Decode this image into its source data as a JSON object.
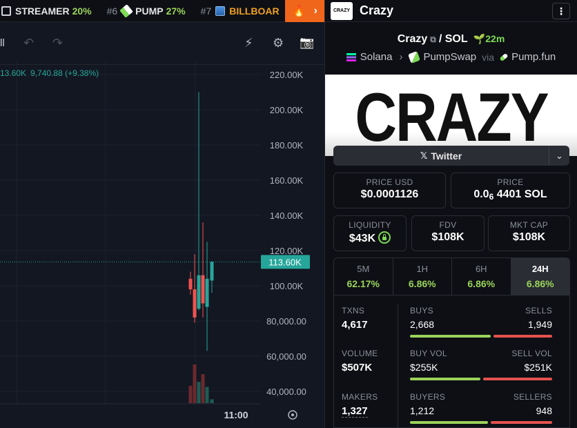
{
  "ticker": {
    "items": [
      {
        "rank": "",
        "symbol": "STREAMER",
        "change": "20%",
        "icon": "tv-icon"
      },
      {
        "rank": "#6",
        "symbol": "PUMP",
        "change": "27%",
        "icon": "pill-icon"
      },
      {
        "rank": "#7",
        "symbol": "BILLBOAR",
        "change": "",
        "icon": "billboard-icon"
      }
    ],
    "fire_icon": "🔥",
    "chevron": "›"
  },
  "toolbar": {
    "left_text": "ll",
    "undo": "↶",
    "redo": "↷",
    "alert": "⚡",
    "settings": "⚙",
    "camera": "📷"
  },
  "chart_data": {
    "type": "candlestick",
    "ohlc_label": {
      "first": "13.60K",
      "second": "9,740.88 (+9.38%)"
    },
    "y_ticks": [
      "220.00K",
      "200.00K",
      "180.00K",
      "160.00K",
      "140.00K",
      "120.00K",
      "100.00K",
      "80,000.00",
      "60,000.00",
      "40,000.00"
    ],
    "y_values": [
      220000,
      200000,
      180000,
      160000,
      140000,
      120000,
      100000,
      80000,
      60000,
      40000
    ],
    "x_label": "11:00",
    "current_price": {
      "label": "113.60K",
      "value": 113600
    },
    "colors": {
      "up": "#26a69a",
      "down": "#ef5350"
    },
    "candles": [
      {
        "o": 104000,
        "h": 108000,
        "l": 95000,
        "c": 98000
      },
      {
        "o": 98000,
        "h": 118000,
        "l": 79000,
        "c": 82000
      },
      {
        "o": 87000,
        "h": 210000,
        "l": 86000,
        "c": 106000
      },
      {
        "o": 106000,
        "h": 136000,
        "l": 82000,
        "c": 90000
      },
      {
        "o": 88000,
        "h": 125000,
        "l": 63000,
        "c": 104000
      },
      {
        "o": 103000,
        "h": 114000,
        "l": 96000,
        "c": 113600
      }
    ],
    "volumes": [
      {
        "v": 0.45,
        "dir": "down"
      },
      {
        "v": 1.0,
        "dir": "down"
      },
      {
        "v": 0.55,
        "dir": "up"
      },
      {
        "v": 0.75,
        "dir": "down"
      },
      {
        "v": 0.42,
        "dir": "up"
      },
      {
        "v": 0.1,
        "dir": "up"
      }
    ]
  },
  "panel": {
    "logo": "CRAZY",
    "name": "Crazy",
    "pair_base": "Crazy",
    "pair_quote": "SOL",
    "age": "22m",
    "chain": "Solana",
    "dex": "PumpSwap",
    "via": "via",
    "launchpad": "Pump.fun",
    "banner_text": "CRAZY",
    "twitter_label": "Twitter",
    "price_usd_label": "PRICE USD",
    "price_usd": "$0.0001126",
    "price_label": "PRICE",
    "price_prefix": "0.0",
    "price_sub": "6",
    "price_rest": "4401 SOL",
    "liquidity_label": "LIQUIDITY",
    "liquidity": "$43K",
    "fdv_label": "FDV",
    "fdv": "$108K",
    "mcap_label": "MKT CAP",
    "mcap": "$108K",
    "timeframes": [
      {
        "label": "5M",
        "value": "62.17%"
      },
      {
        "label": "1H",
        "value": "6.86%"
      },
      {
        "label": "6H",
        "value": "6.86%"
      },
      {
        "label": "24H",
        "value": "6.86%"
      }
    ],
    "stats": {
      "txns_label": "TXNS",
      "txns": "4,617",
      "buys_label": "BUYS",
      "buys": "2,668",
      "sells_label": "SELLS",
      "sells": "1,949",
      "buys_ratio": 0.578,
      "volume_label": "VOLUME",
      "volume": "$507K",
      "buy_vol_label": "BUY VOL",
      "buy_vol": "$255K",
      "sell_vol_label": "SELL VOL",
      "sell_vol": "$251K",
      "buy_vol_ratio": 0.504,
      "makers_label": "MAKERS",
      "makers": "1,327",
      "buyers_label": "BUYERS",
      "buyers": "1,212",
      "sellers_label": "SELLERS",
      "sellers": "948",
      "buyers_ratio": 0.561
    }
  }
}
